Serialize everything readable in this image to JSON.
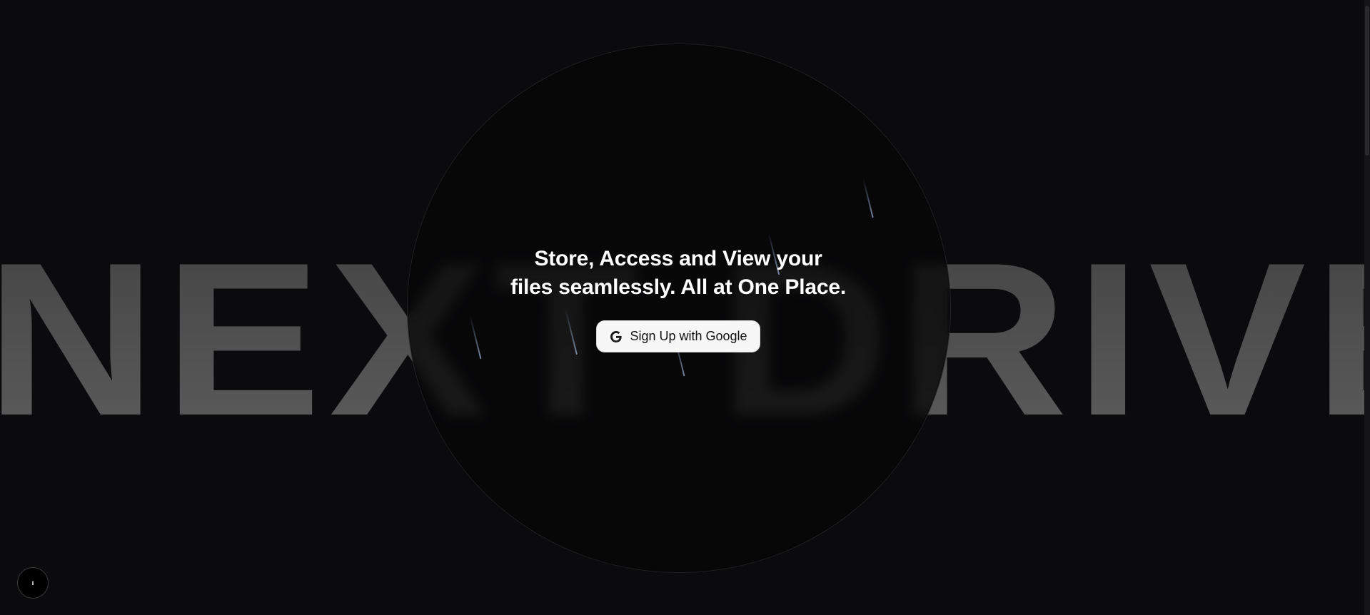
{
  "background": {
    "brand_text": "NEXT DRIVE"
  },
  "hero": {
    "headline_line1": "Store, Access and View your",
    "headline_line2": "files seamlessly. All at One Place."
  },
  "auth": {
    "signup_label": "Sign Up with Google",
    "icon": "google-g-icon"
  },
  "corner_badge": {
    "text": "ı"
  },
  "colors": {
    "page_background": "#0b0b0d",
    "brand_text_gradient_top": "#444444",
    "brand_text_gradient_bottom": "#5c5c5c",
    "button_background": "#f7f7f7",
    "headline_text": "#ffffff",
    "streak": "#8ca0be"
  }
}
